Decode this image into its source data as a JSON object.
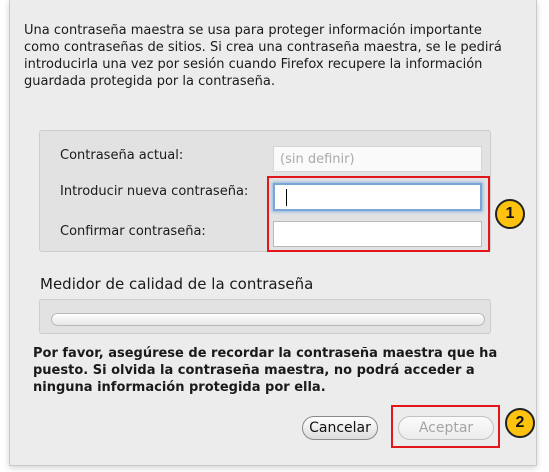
{
  "dialog": {
    "intro_text": "Una contraseña maestra se usa para proteger información importante como contraseñas de sitios. Si crea una contraseña maestra, se le pedirá introducirla una vez por sesión cuando Firefox recupere la información guardada protegida por la contraseña.",
    "fields": {
      "current_label": "Contraseña actual:",
      "current_value": "(sin definir)",
      "new_label": "Introducir nueva contraseña:",
      "new_value": "",
      "confirm_label": "Confirmar contraseña:",
      "confirm_value": ""
    },
    "meter": {
      "title": "Medidor de calidad de la contraseña",
      "level": 0
    },
    "warning_text": "Por favor, asegúrese de recordar la contraseña maestra que ha puesto. Si olvida la contraseña maestra, no podrá acceder a ninguna información protegida por ella.",
    "buttons": {
      "cancel_label": "Cancelar",
      "ok_label": "Aceptar"
    }
  },
  "annotations": {
    "badge_1": "1",
    "badge_2": "2",
    "highlight_color": "#e3161b",
    "badge_color": "#ffc20e"
  }
}
